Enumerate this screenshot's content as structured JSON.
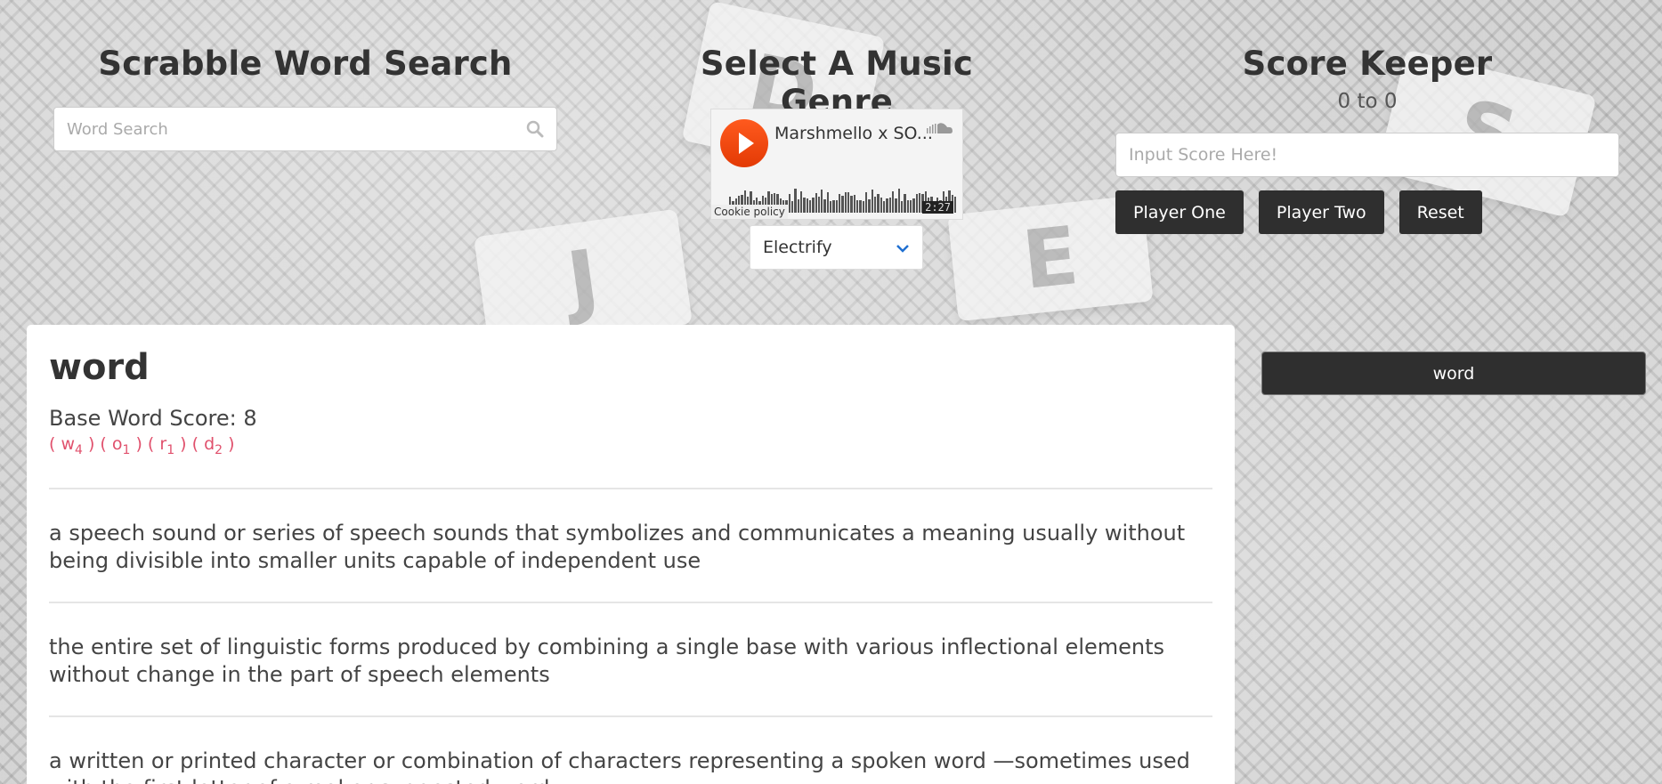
{
  "search": {
    "title": "Scrabble Word Search",
    "placeholder": "Word Search"
  },
  "music": {
    "title": "Select A Music Genre",
    "track_title": "Marshmello x SO...",
    "duration": "2:27",
    "cookie_label": "Cookie policy",
    "genre_selected": "Electrify"
  },
  "score": {
    "title": "Score Keeper",
    "score_text": "0 to 0",
    "input_placeholder": "Input Score Here!",
    "buttons": {
      "player_one": "Player One",
      "player_two": "Player Two",
      "reset": "Reset"
    }
  },
  "word": {
    "title": "word",
    "base_score_text": "Base Word Score: 8",
    "letters": [
      {
        "letter": "w",
        "value": "4"
      },
      {
        "letter": "o",
        "value": "1"
      },
      {
        "letter": "r",
        "value": "1"
      },
      {
        "letter": "d",
        "value": "2"
      }
    ],
    "definitions": [
      "a speech sound or series of speech sounds that symbolizes and communicates a meaning usually without being divisible into smaller units capable of independent use",
      "the entire set of linguistic forms produced by combining a single base with various inflectional elements without change in the part of speech elements",
      "a written or printed character or combination of characters representing a spoken word —sometimes used with the first letter of a real or suggested word"
    ]
  },
  "history": {
    "items": [
      "word"
    ]
  },
  "colors": {
    "accent_pink": "#e0506c",
    "dark_button": "#2f2f2f",
    "soundcloud_orange": "#f1420a"
  },
  "icons": {
    "search": "search-icon",
    "soundcloud": "soundcloud-icon",
    "dropdown": "chevron-down-icon",
    "play": "play-icon"
  }
}
